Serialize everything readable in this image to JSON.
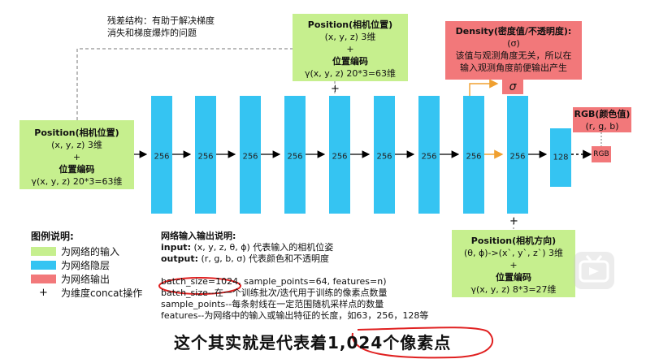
{
  "residual_note": [
    "残差结构：有助于解决梯度",
    "消失和梯度爆炸的问题"
  ],
  "input_box": {
    "title": "Position(相机位置)",
    "line1": "(x, y, z) 3维",
    "plus": "+",
    "line2": "位置编码",
    "line3": "γ(x, y, z)  20*3=63维"
  },
  "concat_box_top": {
    "title": "Position(相机位置)",
    "line1": "(x, y, z) 3维",
    "plus": "+",
    "line2": "位置编码",
    "line3": "γ(x, y, z)  20*3=63维"
  },
  "density_box": {
    "title": "Density(密度值/不透明度):",
    "line1": "(σ)",
    "line2": "该值与观测角度无关，所以在",
    "line3": "输入观测角度前便输出产生"
  },
  "rgb_box": {
    "title": "RGB(颜色值)",
    "line1": "(r, g, b)"
  },
  "direction_box": {
    "title": "Position(相机方向)",
    "line1": "(θ, ϕ)->(x`, y`, z`) 3维",
    "plus": "+",
    "line2": "位置编码",
    "line3": "γ(x, y, z)  8*3=27维"
  },
  "layers": [
    "256",
    "256",
    "256",
    "256",
    "256",
    "256",
    "256",
    "256",
    "256",
    "128"
  ],
  "plus_marks": {
    "top": "+",
    "bottom": "+"
  },
  "sigma_label": "σ",
  "rgb_output": "RGB",
  "legend": {
    "title": "图例说明:",
    "items": [
      "为网络的输入",
      "为网络隐层",
      "为网络输出",
      "为维度concat操作"
    ],
    "plus": "+",
    "colors": [
      "#c6ef8e",
      "#35c4f2",
      "#f2787a"
    ]
  },
  "io_info": {
    "title": "网络输入输出说明:",
    "input_key": "input:",
    "input_text": " (x, y, z, θ, ϕ) 代表输入的相机位姿",
    "output_key": "output:",
    "output_text": " (r, g, b, σ) 代表颜色和不透明度",
    "batch_key": "batch_size",
    "batch_eq": "=1024,",
    "batch_rest": " sample_points=64, features=n)",
    "line_batch": "batch_size--在一个训练批次/迭代用于训练的像素点数量",
    "line_sample": "sample_points--每条射线在一定范围随机采样点的数量",
    "line_features": "features--为网络中的输入或输出特征的长度，如63，256，128等"
  },
  "subtitle": {
    "prefix": "这个其实就是代表着",
    "highlight": "1,024个像素点"
  },
  "colors": {
    "green": "#c6ef8e",
    "blue": "#35c4f2",
    "red": "#f2787a",
    "arrow_orange": "#f0a030",
    "annotation_red": "#e02020"
  }
}
